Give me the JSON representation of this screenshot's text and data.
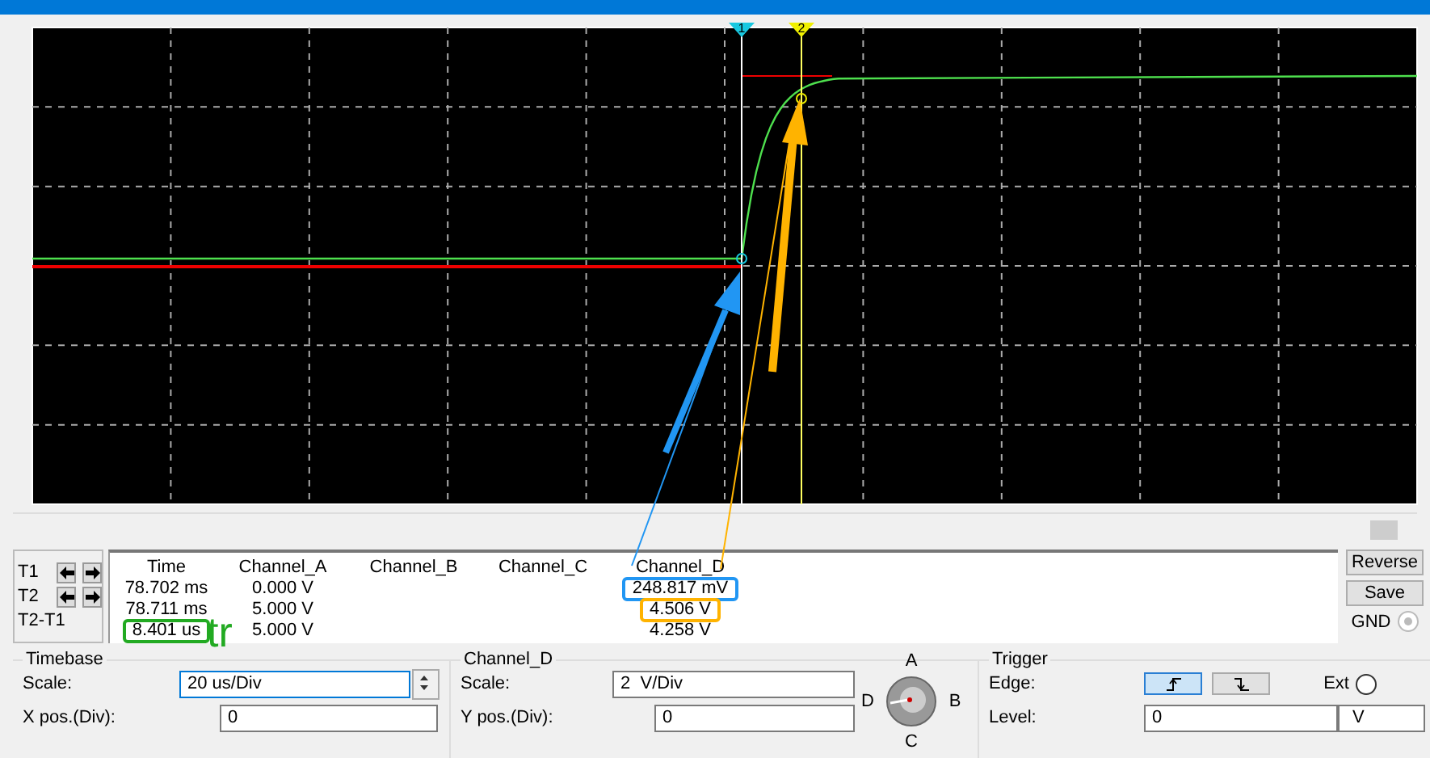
{
  "scope": {
    "cursors": [
      {
        "label": "1",
        "color": "#19c8e0"
      },
      {
        "label": "2",
        "color": "#f0f000"
      }
    ]
  },
  "readout": {
    "row_labels": [
      {
        "label": "T1",
        "arrows": true
      },
      {
        "label": "T2",
        "arrows": true
      },
      {
        "label": "T2-T1",
        "arrows": false
      }
    ],
    "columns": [
      "Time",
      "Channel_A",
      "Channel_B",
      "Channel_C",
      "Channel_D"
    ],
    "rows": [
      [
        {
          "text": "78.702 ms"
        },
        {
          "text": "0.000 V"
        },
        {
          "text": ""
        },
        {
          "text": ""
        },
        {
          "text": "248.817 mV",
          "color": "#2196f3"
        }
      ],
      [
        {
          "text": "78.711 ms"
        },
        {
          "text": "5.000 V"
        },
        {
          "text": ""
        },
        {
          "text": ""
        },
        {
          "text": "4.506 V",
          "color": "#ffb300"
        }
      ],
      [
        {
          "text": "8.401 us",
          "color": "#22aa22"
        },
        {
          "text": "5.000 V"
        },
        {
          "text": ""
        },
        {
          "text": ""
        },
        {
          "text": "4.258 V"
        }
      ]
    ]
  },
  "side_buttons": [
    "Reverse",
    "Save"
  ],
  "gnd": {
    "label": "GND",
    "disabled": true
  },
  "annotation": {
    "text": "tr"
  },
  "timebase": {
    "title": "Timebase",
    "scale_label": "Scale:",
    "scale_value": "20 us/Div",
    "xpos_label": "X pos.(Div):",
    "xpos_value": "0"
  },
  "channel": {
    "title": "Channel_D",
    "scale_label": "Scale:",
    "scale_value": "2  V/Div",
    "ypos_label": "Y pos.(Div):",
    "ypos_value": "0",
    "knob": [
      "A",
      "B",
      "C",
      "D"
    ]
  },
  "trigger": {
    "title": "Trigger",
    "edge_label": "Edge:",
    "edges": [
      {
        "kind": "rising",
        "selected": true
      },
      {
        "kind": "falling",
        "selected": false
      }
    ],
    "ext_label": "Ext",
    "ext_checked": false,
    "level_label": "Level:",
    "level_value": "0",
    "level_unit": "V"
  }
}
